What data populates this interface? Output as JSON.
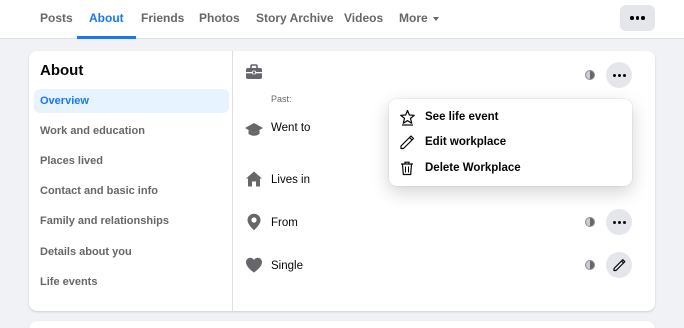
{
  "tabs": [
    {
      "label": "Posts"
    },
    {
      "label": "About"
    },
    {
      "label": "Friends"
    },
    {
      "label": "Photos"
    },
    {
      "label": "Story Archive"
    },
    {
      "label": "Videos"
    },
    {
      "label": "More"
    }
  ],
  "active_tab": "About",
  "about": {
    "title": "About",
    "nav": [
      {
        "label": "Overview"
      },
      {
        "label": "Work and education"
      },
      {
        "label": "Places lived"
      },
      {
        "label": "Contact and basic info"
      },
      {
        "label": "Family and relationships"
      },
      {
        "label": "Details about you"
      },
      {
        "label": "Life events"
      }
    ]
  },
  "overview": {
    "past_label": "Past:",
    "went_to": "Went to",
    "lives_in": "Lives in",
    "from": "From",
    "relationship": "Single"
  },
  "menu": {
    "items": [
      {
        "label": "See life event",
        "icon": "star-icon"
      },
      {
        "label": "Edit workplace",
        "icon": "pencil-icon"
      },
      {
        "label": "Delete Workplace",
        "icon": "trash-icon"
      }
    ]
  },
  "colors": {
    "accent": "#1877f2",
    "active_nav_bg": "#e7f3ff",
    "icon_grey": "#65676b",
    "page_bg": "#f0f2f5"
  }
}
